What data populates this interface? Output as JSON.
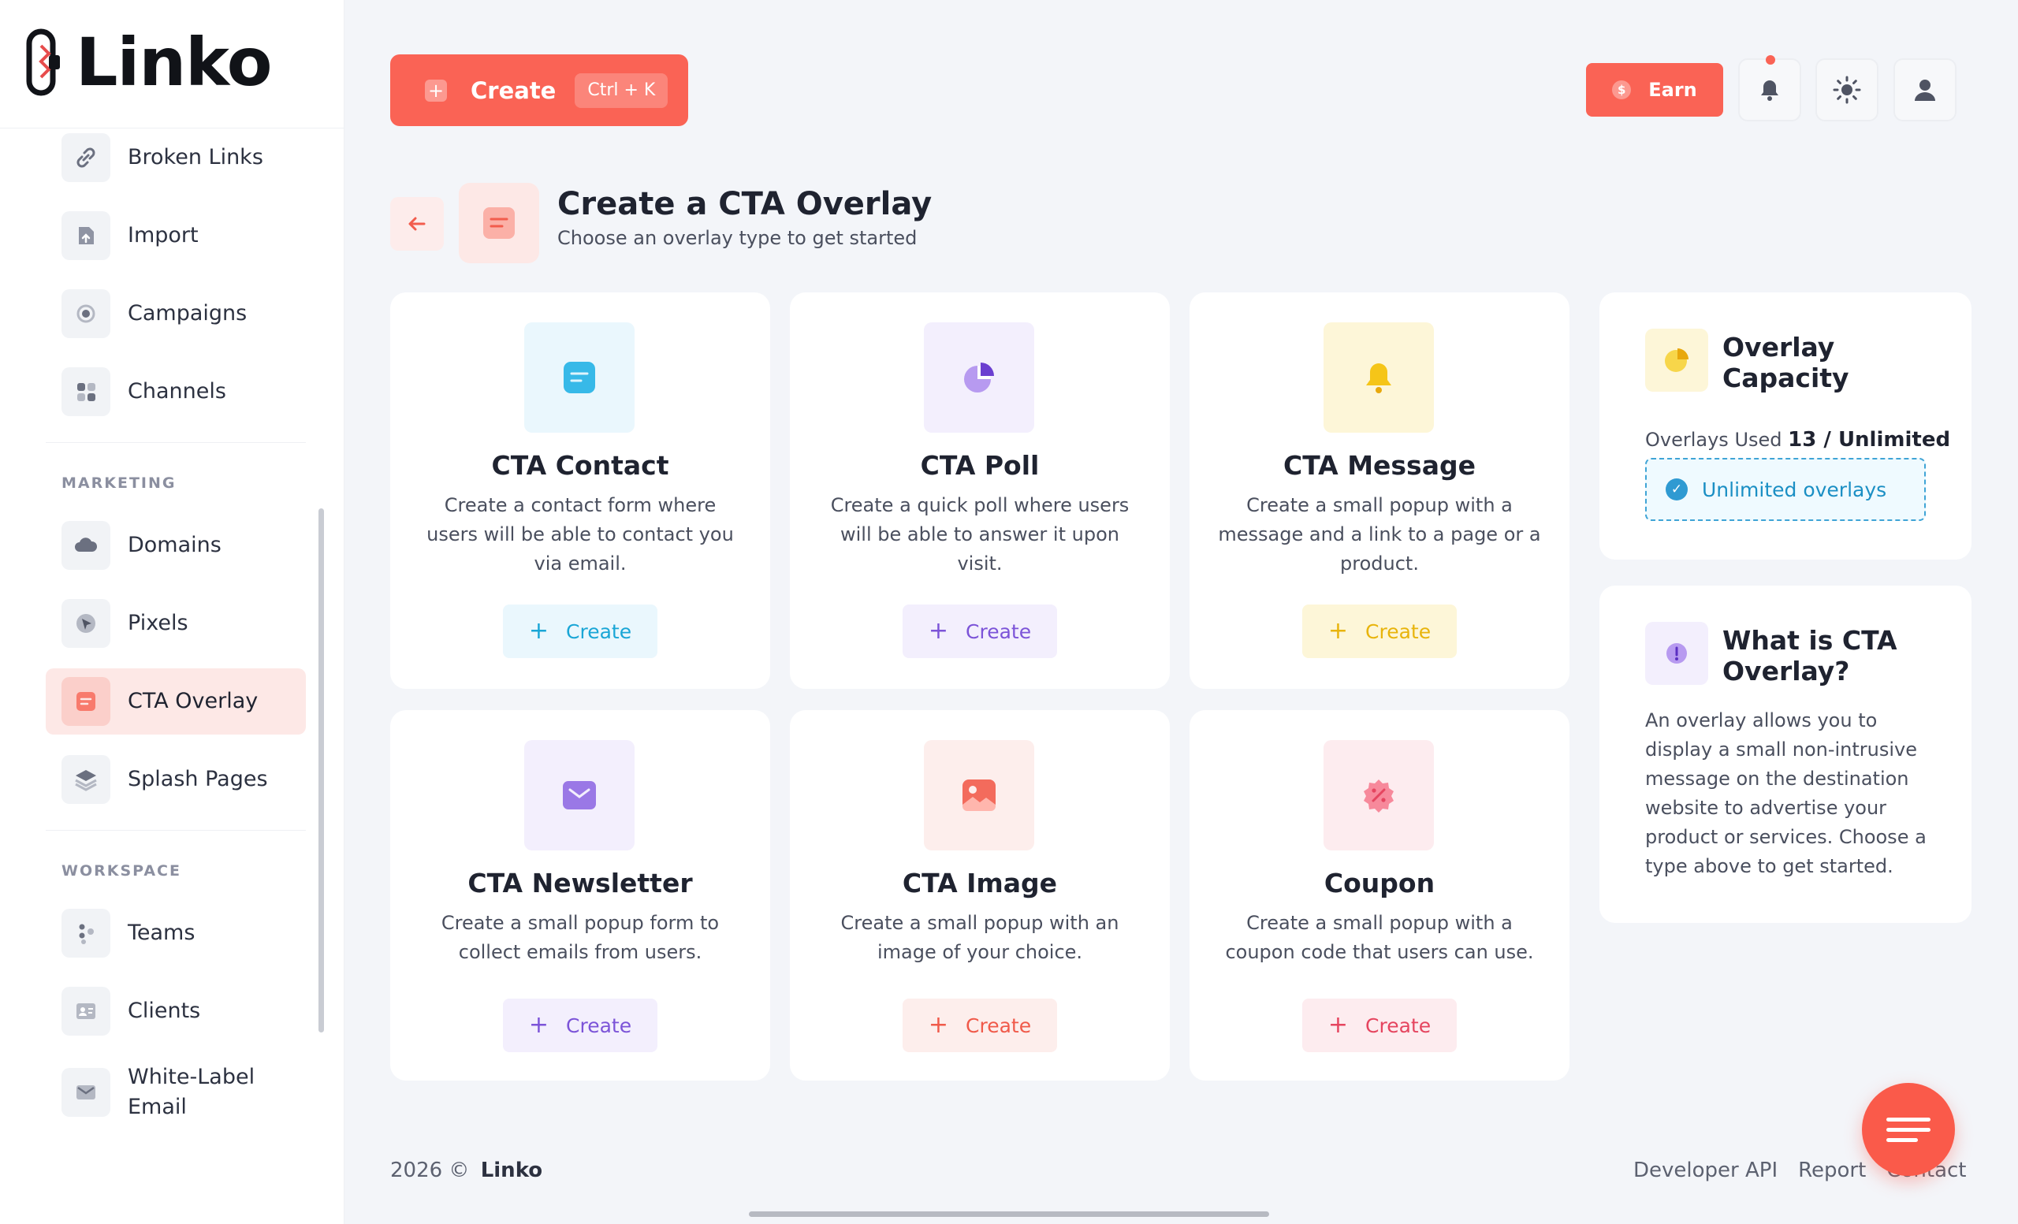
{
  "brand": {
    "name": "Linko"
  },
  "sidebar": {
    "items_top": [
      {
        "label": "Broken Links",
        "icon": "broken-link-icon"
      },
      {
        "label": "Import",
        "icon": "import-icon"
      },
      {
        "label": "Campaigns",
        "icon": "campaigns-icon"
      },
      {
        "label": "Channels",
        "icon": "channels-icon"
      }
    ],
    "marketing_heading": "MARKETING",
    "items_marketing": [
      {
        "label": "Domains",
        "icon": "cloud-icon"
      },
      {
        "label": "Pixels",
        "icon": "pixel-icon"
      },
      {
        "label": "CTA Overlay",
        "icon": "cta-overlay-icon",
        "active": true
      },
      {
        "label": "Splash Pages",
        "icon": "layers-icon"
      }
    ],
    "workspace_heading": "WORKSPACE",
    "items_workspace": [
      {
        "label": "Teams",
        "icon": "teams-icon"
      },
      {
        "label": "Clients",
        "icon": "clients-icon"
      },
      {
        "label": "White-Label Email",
        "icon": "mail-icon"
      }
    ]
  },
  "topbar": {
    "create_label": "Create",
    "create_shortcut": "Ctrl + K",
    "earn_label": "Earn",
    "earn_coin": "$"
  },
  "header": {
    "title": "Create a CTA Overlay",
    "subtitle": "Choose an overlay type to get started"
  },
  "cards": [
    {
      "title": "CTA Contact",
      "description": "Create a contact form where users will be able to contact you via email.",
      "button": "Create",
      "accent": "#1aa6d6",
      "icon_bg": "#eaf7fd",
      "btn_bg": "#eaf7fd"
    },
    {
      "title": "CTA Poll",
      "description": "Create a quick poll where users will be able to answer it upon visit.",
      "button": "Create",
      "accent": "#7c54d8",
      "icon_bg": "#f3effd",
      "btn_bg": "#f3effd"
    },
    {
      "title": "CTA Message",
      "description": "Create a small popup with a message and a link to a page or a product.",
      "button": "Create",
      "accent": "#e8b40c",
      "icon_bg": "#fdf6d8",
      "btn_bg": "#fdf6d8"
    },
    {
      "title": "CTA Newsletter",
      "description": "Create a small popup form to collect emails from users.",
      "button": "Create",
      "accent": "#7c54d8",
      "icon_bg": "#f3effd",
      "btn_bg": "#f3effd"
    },
    {
      "title": "CTA Image",
      "description": "Create a small popup with an image of your choice.",
      "button": "Create",
      "accent": "#f05a4a",
      "icon_bg": "#fdeeec",
      "btn_bg": "#fdeeec"
    },
    {
      "title": "Coupon",
      "description": "Create a small popup with a coupon code that users can use.",
      "button": "Create",
      "accent": "#e5455f",
      "icon_bg": "#fdecef",
      "btn_bg": "#fdecef"
    }
  ],
  "capacity": {
    "title": "Overlay Capacity",
    "used_label": "Overlays Used",
    "used_value": "13 / Unlimited",
    "badge": "Unlimited overlays"
  },
  "about": {
    "title": "What is CTA Overlay?",
    "description": "An overlay allows you to display a small non-intrusive message on the destination website to advertise your product or services. Choose a type above to get started."
  },
  "footer": {
    "copyright": "2026 ©",
    "brand": "Linko",
    "links": [
      "Developer API",
      "Report",
      "Contact"
    ]
  },
  "colors": {
    "accent": "#fa6355",
    "background": "#f3f5f9"
  }
}
